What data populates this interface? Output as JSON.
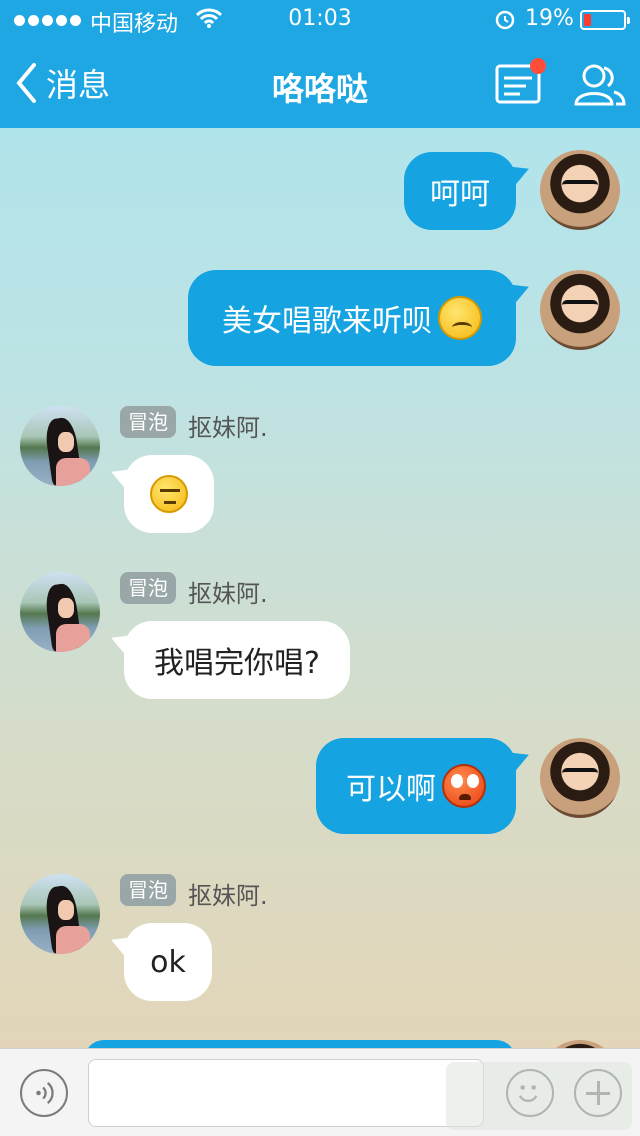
{
  "status_bar": {
    "carrier": "中国移动",
    "time": "01:03",
    "battery_percent": "19%",
    "battery_level": 0.19
  },
  "header": {
    "back_label": "消息",
    "title": "咯咯哒",
    "icons": [
      "message-list-icon",
      "friends-icon"
    ]
  },
  "messages": [
    {
      "side": "out",
      "text": "呵呵",
      "emoji": null
    },
    {
      "side": "out",
      "text": "美女唱歌来听呗",
      "emoji": "confused"
    },
    {
      "side": "in",
      "tag": "冒泡",
      "sender": "抠妹阿.",
      "text": "",
      "emoji": "meh"
    },
    {
      "side": "in",
      "tag": "冒泡",
      "sender": "抠妹阿.",
      "text": "我唱完你唱?",
      "emoji": null
    },
    {
      "side": "out",
      "text": "可以啊",
      "emoji": "shocked"
    },
    {
      "side": "in",
      "tag": "冒泡",
      "sender": "抠妹阿.",
      "text": "ok",
      "emoji": null
    }
  ],
  "input": {
    "value": "",
    "placeholder": ""
  },
  "colors": {
    "header": "#1fa7e4",
    "outgoing_bubble": "#15a3e2",
    "incoming_bubble": "#ffffff"
  }
}
